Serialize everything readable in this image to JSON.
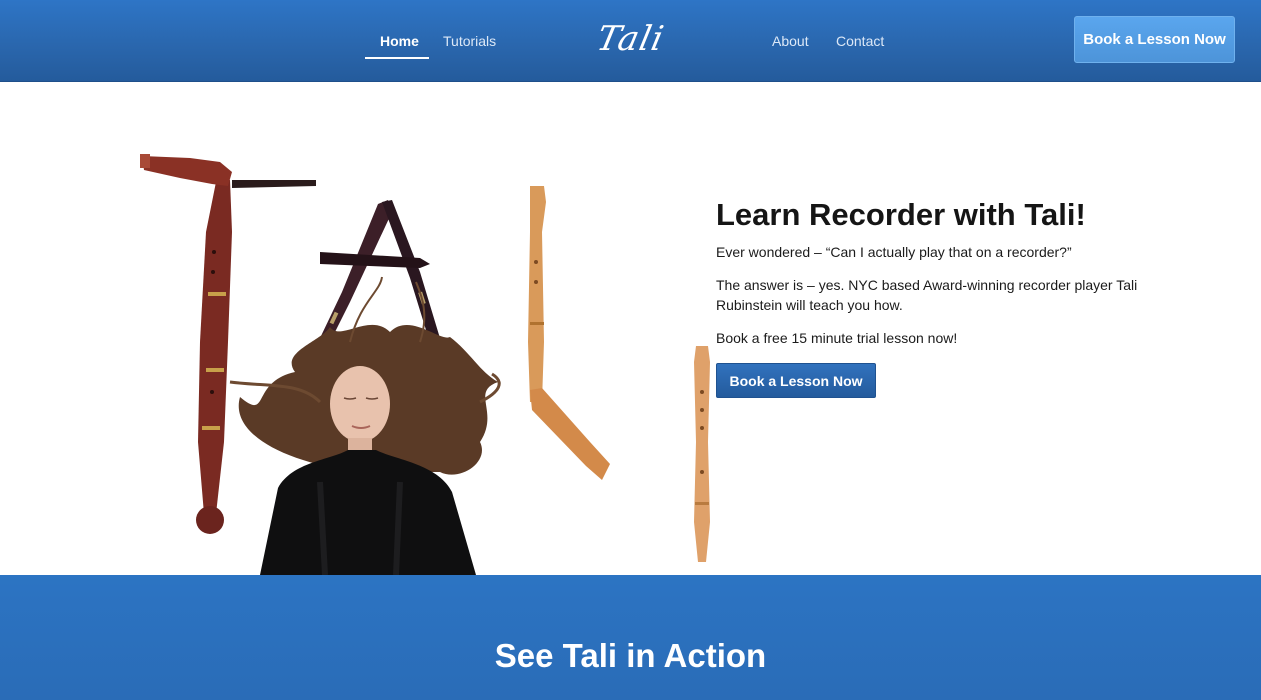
{
  "header": {
    "nav_left": [
      {
        "label": "Home",
        "active": true
      },
      {
        "label": "Tutorials",
        "active": false
      }
    ],
    "logo_text": "Tali Rubinstein",
    "nav_right": [
      {
        "label": "About"
      },
      {
        "label": "Contact"
      }
    ],
    "cta_label": "Book a Lesson Now"
  },
  "hero": {
    "title": "Learn Recorder with Tali!",
    "paragraphs": [
      "Ever wondered – “Can I actually play that on a recorder?”",
      "The answer is – yes. NYC based Award-winning recorder player Tali Rubinstein will teach you how.",
      "Book a free 15 minute trial lesson now!"
    ],
    "cta_label": "Book a Lesson Now"
  },
  "section": {
    "title": "See Tali in Action"
  },
  "colors": {
    "header_blue": "#2a67ae",
    "band_blue": "#2c74c3",
    "button_blue": "#2a65ab",
    "header_cta": "#4d94d9"
  }
}
